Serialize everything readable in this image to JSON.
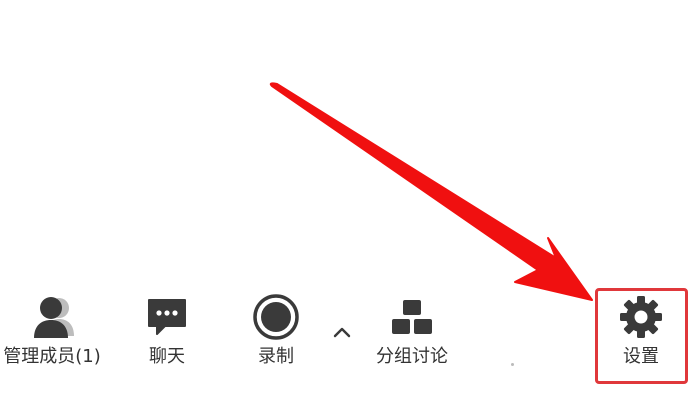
{
  "toolbar": {
    "items": [
      {
        "id": "members",
        "label": "管理成员(1)",
        "icon": "members-icon"
      },
      {
        "id": "chat",
        "label": "聊天",
        "icon": "chat-icon"
      },
      {
        "id": "record",
        "label": "录制",
        "icon": "record-icon"
      },
      {
        "id": "groups",
        "label": "分组讨论",
        "icon": "breakout-rooms-icon"
      },
      {
        "id": "settings",
        "label": "设置",
        "icon": "gear-icon"
      }
    ],
    "more_icon": "chevron-up-icon"
  },
  "colors": {
    "icon": "#3a3a3a",
    "label": "#333333",
    "annotation": "#e0383b",
    "arrow": "#f01010"
  }
}
